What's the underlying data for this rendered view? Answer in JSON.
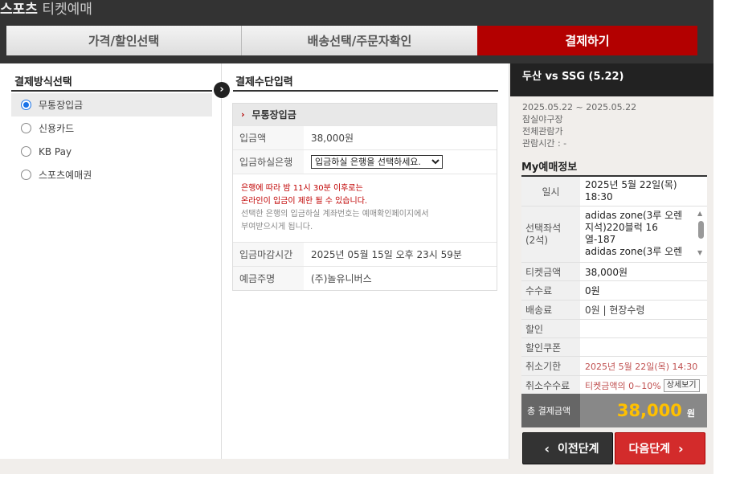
{
  "header": {
    "brand_bold": "스포츠",
    "brand_rest": " 티켓예매"
  },
  "steps": [
    "가격/할인선택",
    "배송선택/주문자확인",
    "결제하기"
  ],
  "left": {
    "title": "결제방식선택",
    "methods": [
      {
        "label": "무통장입금",
        "selected": true
      },
      {
        "label": "신용카드",
        "selected": false
      },
      {
        "label": "KB Pay",
        "selected": false
      },
      {
        "label": "스포츠예매권",
        "selected": false
      }
    ]
  },
  "middle": {
    "title": "결제수단입력",
    "box_title": "무통장입금",
    "amount_label": "입금액",
    "amount_value": "38,000원",
    "bank_label": "입금하실은행",
    "bank_select": "입금하실 은행을 선택하세요.",
    "notice_red_1": "은행에 따라 밤 11시 30분 이후로는",
    "notice_red_2": "온라인이 입금이 제한 될 수 있습니다.",
    "notice_gray_1": "선택한 은행의 입금하실 계좌번호는 예매확인페이지에서",
    "notice_gray_2": "부여받으시게 됩니다.",
    "deadline_label": "입금마감시간",
    "deadline_value": "2025년 05월 15일 오후 23시 59분",
    "depositor_label": "예금주명",
    "depositor_value": "(주)놀유니버스"
  },
  "right": {
    "game": "두산 vs SSG (5.22)",
    "date_range": "2025.05.22 ~ 2025.05.22",
    "venue": "잠실야구장",
    "rating": "전체관람가",
    "runtime": "관람시간 : -",
    "my_title": "My예매정보",
    "rows": {
      "date_label": "일시",
      "date_value_1": "2025년 5월 22일(목)",
      "date_value_2": "18:30",
      "seat_label_1": "선택좌석",
      "seat_label_2": "(2석)",
      "seat_value_1": "adidas zone(3루 오렌",
      "seat_value_2": "지석)220블럭 16",
      "seat_value_3": "열-187",
      "seat_value_4": "adidas zone(3루 오렌",
      "ticket_label": "티켓금액",
      "ticket_value": "38,000원",
      "fee_label": "수수료",
      "fee_value": "0원",
      "delivery_label": "배송료",
      "delivery_value": "0원 | 현장수령",
      "discount_label": "할인",
      "coupon_label": "할인쿠폰",
      "cancel_deadline_label": "취소기한",
      "cancel_deadline_value": "2025년 5월 22일(목) 14:30",
      "cancel_fee_label": "취소수수료",
      "cancel_fee_value": "티켓금액의 0~10%",
      "detail_btn": "상세보기"
    },
    "total_label": "총 결제금액",
    "total_value": "38,000",
    "total_unit": "원",
    "prev_btn": "이전단계",
    "next_btn": "다음단계"
  },
  "colors": {
    "accent": "#b30000",
    "total_amount": "#ffc000",
    "dark": "#333333"
  }
}
